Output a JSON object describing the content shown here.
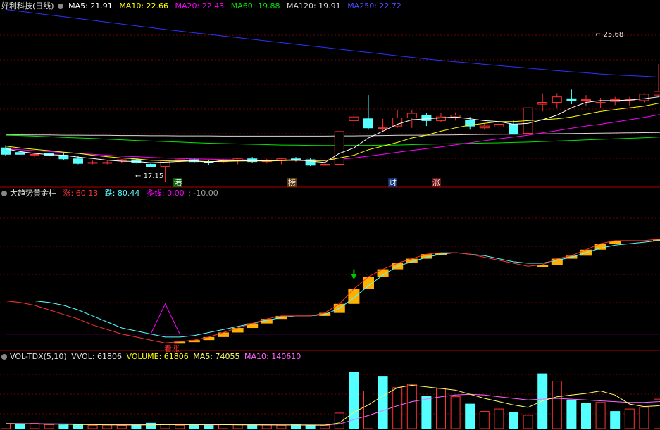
{
  "colors": {
    "up": "#ff3232",
    "down": "#54ffff",
    "ma5": "#ffffff",
    "ma10": "#ffff00",
    "ma20": "#ff00ff",
    "ma60": "#00e600",
    "ma120": "#d8d8d8",
    "ma250": "#3030ff",
    "gold": "#ffb000",
    "vol_ma5": "#ffff66",
    "vol_ma10": "#ff66ff"
  },
  "main_header": {
    "title": "好利科技(日线)",
    "ma5": "MA5: 21.91",
    "ma10": "MA10: 22.66",
    "ma20": "MA20: 22.43",
    "ma60": "MA60: 19.88",
    "ma120": "MA120: 19.91",
    "ma250": "MA250: 22.72"
  },
  "badges": [
    {
      "text": "港",
      "bg": "#0c5f0c",
      "fg": "#ffffff"
    },
    {
      "text": "榜",
      "bg": "#5f3a0c",
      "fg": "#ffffff"
    },
    {
      "text": "财",
      "bg": "#0c2f6f",
      "fg": "#ffffff"
    },
    {
      "text": "涨",
      "bg": "#6f0c0c",
      "fg": "#ffffff"
    }
  ],
  "price_labels": {
    "high": "25.68",
    "low": "17.15"
  },
  "ind_header": {
    "title": "大趋势黄金柱",
    "zhang": "涨: 60.13",
    "die": "跌: 80.44",
    "duoxian": "多线: 0.00",
    "extra": ": -10.00"
  },
  "ind_label": "看涨",
  "vol_header": {
    "title": "VOL-TDX(5,10)",
    "vvol": "VVOL: 61806",
    "volume": "VOLUME: 61806",
    "ma5": "MA5: 74055",
    "ma10": "MA10: 140610"
  },
  "chart_data": [
    {
      "type": "candlestick",
      "title": "好利科技(日线)",
      "ylim": [
        17.0,
        26.5
      ],
      "ohlc": [
        [
          19.0,
          19.15,
          18.55,
          18.65
        ],
        [
          18.75,
          18.85,
          18.6,
          18.65
        ],
        [
          18.65,
          18.75,
          18.5,
          18.65
        ],
        [
          18.7,
          18.75,
          18.55,
          18.6
        ],
        [
          18.6,
          18.7,
          18.35,
          18.4
        ],
        [
          18.4,
          18.55,
          18.1,
          18.15
        ],
        [
          18.2,
          18.3,
          18.1,
          18.2
        ],
        [
          18.2,
          18.3,
          18.1,
          18.2
        ],
        [
          18.3,
          18.4,
          18.2,
          18.35
        ],
        [
          18.35,
          18.4,
          18.15,
          18.2
        ],
        [
          18.1,
          18.15,
          17.95,
          17.98
        ],
        [
          17.98,
          18.35,
          17.15,
          18.3
        ],
        [
          18.3,
          18.4,
          18.2,
          18.35
        ],
        [
          18.35,
          18.45,
          18.2,
          18.25
        ],
        [
          18.25,
          18.35,
          18.05,
          18.2
        ],
        [
          18.25,
          18.4,
          18.15,
          18.3
        ],
        [
          18.3,
          18.45,
          18.1,
          18.4
        ],
        [
          18.4,
          18.5,
          18.2,
          18.25
        ],
        [
          18.25,
          18.4,
          18.15,
          18.3
        ],
        [
          18.3,
          18.45,
          18.1,
          18.4
        ],
        [
          18.4,
          18.5,
          18.25,
          18.35
        ],
        [
          18.35,
          18.45,
          18.0,
          18.05
        ],
        [
          18.05,
          18.15,
          18.0,
          18.1
        ],
        [
          18.1,
          19.9,
          18.05,
          19.9
        ],
        [
          20.5,
          20.9,
          20.0,
          20.7
        ],
        [
          20.6,
          21.9,
          20.0,
          20.1
        ],
        [
          20.1,
          20.6,
          19.9,
          20.1
        ],
        [
          20.2,
          21.1,
          20.1,
          20.65
        ],
        [
          20.65,
          21.1,
          20.1,
          20.9
        ],
        [
          20.8,
          20.9,
          20.2,
          20.5
        ],
        [
          20.5,
          20.9,
          20.4,
          20.7
        ],
        [
          20.7,
          20.95,
          20.5,
          20.8
        ],
        [
          20.5,
          20.7,
          20.0,
          20.2
        ],
        [
          20.1,
          20.35,
          20.0,
          20.2
        ],
        [
          20.15,
          20.4,
          20.05,
          20.3
        ],
        [
          20.3,
          20.5,
          19.8,
          19.8
        ],
        [
          19.8,
          21.2,
          19.75,
          21.2
        ],
        [
          21.4,
          22.0,
          21.0,
          21.5
        ],
        [
          21.5,
          22.0,
          21.2,
          21.8
        ],
        [
          21.7,
          22.2,
          21.4,
          21.6
        ],
        [
          21.65,
          21.9,
          21.3,
          21.65
        ],
        [
          21.5,
          21.75,
          21.2,
          21.5
        ],
        [
          21.55,
          21.8,
          21.35,
          21.65
        ],
        [
          21.6,
          21.8,
          21.3,
          21.65
        ],
        [
          21.6,
          22.0,
          21.5,
          21.95
        ],
        [
          21.9,
          23.6,
          21.8,
          22.1
        ],
        [
          22.1,
          24.3,
          22.0,
          23.7
        ],
        [
          23.0,
          24.0,
          22.8,
          23.2
        ],
        [
          23.2,
          24.8,
          23.0,
          24.4
        ],
        [
          24.7,
          25.68,
          22.9,
          24.9
        ],
        [
          24.7,
          25.0,
          23.7,
          24.0
        ],
        [
          23.4,
          23.7,
          22.8,
          22.7
        ],
        [
          22.7,
          23.2,
          22.4,
          23.1
        ],
        [
          23.0,
          23.3,
          22.3,
          22.4
        ]
      ],
      "ma5": [
        18.95,
        18.8,
        18.7,
        18.63,
        18.6,
        18.5,
        18.42,
        18.33,
        18.27,
        18.26,
        18.19,
        18.22,
        18.26,
        18.29,
        18.22,
        18.3,
        18.3,
        18.29,
        18.3,
        18.33,
        18.35,
        18.28,
        18.2,
        18.7,
        19.0,
        19.55,
        19.92,
        20.3,
        20.55,
        20.6,
        20.65,
        20.7,
        20.6,
        20.5,
        20.45,
        20.3,
        20.35,
        20.55,
        20.8,
        21.2,
        21.5,
        21.6,
        21.6,
        21.63,
        21.7,
        21.8,
        22.25,
        22.65,
        23.05,
        23.7,
        23.95,
        23.9,
        23.55,
        23.0
      ],
      "ma10": [
        19.1,
        19.0,
        18.92,
        18.85,
        18.77,
        18.7,
        18.6,
        18.52,
        18.45,
        18.4,
        18.32,
        18.3,
        18.3,
        18.28,
        18.25,
        18.26,
        18.28,
        18.29,
        18.28,
        18.3,
        18.32,
        18.3,
        18.3,
        18.45,
        18.6,
        18.9,
        19.1,
        19.3,
        19.55,
        19.7,
        19.92,
        20.1,
        20.25,
        20.35,
        20.45,
        20.45,
        20.5,
        20.55,
        20.6,
        20.7,
        20.85,
        21.0,
        21.1,
        21.2,
        21.3,
        21.45,
        21.6,
        21.8,
        22.0,
        22.3,
        22.6,
        22.8,
        22.9,
        22.66
      ],
      "ma20": [
        18.95,
        18.9,
        18.85,
        18.8,
        18.75,
        18.7,
        18.65,
        18.6,
        18.55,
        18.52,
        18.48,
        18.45,
        18.42,
        18.4,
        18.38,
        18.36,
        18.35,
        18.34,
        18.33,
        18.32,
        18.3,
        18.3,
        18.32,
        18.37,
        18.45,
        18.55,
        18.65,
        18.76,
        18.86,
        18.96,
        19.06,
        19.17,
        19.28,
        19.4,
        19.5,
        19.6,
        19.7,
        19.83,
        19.95,
        20.08,
        20.2,
        20.3,
        20.42,
        20.55,
        20.68,
        20.82,
        20.97,
        21.12,
        21.3,
        21.5,
        21.7,
        21.9,
        22.2,
        22.43
      ],
      "ma60": [
        19.7,
        19.68,
        19.65,
        19.62,
        19.58,
        19.55,
        19.52,
        19.48,
        19.45,
        19.41,
        19.38,
        19.35,
        19.32,
        19.29,
        19.26,
        19.24,
        19.22,
        19.2,
        19.18,
        19.16,
        19.15,
        19.14,
        19.13,
        19.13,
        19.13,
        19.14,
        19.15,
        19.16,
        19.18,
        19.2,
        19.22,
        19.23,
        19.25,
        19.27,
        19.28,
        19.3,
        19.32,
        19.35,
        19.38,
        19.41,
        19.44,
        19.47,
        19.5,
        19.53,
        19.56,
        19.6,
        19.63,
        19.67,
        19.7,
        19.73,
        19.77,
        19.8,
        19.84,
        19.88
      ],
      "ma120": [
        19.72,
        19.72,
        19.71,
        19.71,
        19.7,
        19.7,
        19.69,
        19.69,
        19.68,
        19.68,
        19.67,
        19.67,
        19.66,
        19.66,
        19.66,
        19.65,
        19.65,
        19.65,
        19.65,
        19.65,
        19.65,
        19.65,
        19.65,
        19.66,
        19.66,
        19.67,
        19.68,
        19.69,
        19.7,
        19.7,
        19.71,
        19.72,
        19.73,
        19.74,
        19.75,
        19.75,
        19.76,
        19.77,
        19.78,
        19.79,
        19.8,
        19.81,
        19.82,
        19.83,
        19.84,
        19.85,
        19.86,
        19.87,
        19.88,
        19.89,
        19.9,
        19.9,
        19.91,
        19.91
      ],
      "ma250": [
        26.6,
        26.5,
        26.4,
        26.3,
        26.2,
        26.1,
        26.0,
        25.9,
        25.8,
        25.7,
        25.6,
        25.5,
        25.41,
        25.32,
        25.23,
        25.14,
        25.05,
        24.96,
        24.87,
        24.78,
        24.69,
        24.6,
        24.51,
        24.42,
        24.33,
        24.24,
        24.15,
        24.06,
        23.97,
        23.88,
        23.8,
        23.73,
        23.66,
        23.59,
        23.52,
        23.45,
        23.38,
        23.31,
        23.24,
        23.18,
        23.12,
        23.06,
        23.01,
        22.97,
        22.93,
        22.89,
        22.86,
        22.83,
        22.8,
        22.78,
        22.76,
        22.74,
        22.73,
        22.72
      ]
    },
    {
      "type": "line",
      "title": "大趋势黄金柱",
      "ylim": [
        0,
        100
      ],
      "series": [
        {
          "name": "涨",
          "values": [
            32,
            31,
            29,
            26,
            23,
            20,
            16,
            13,
            10,
            8,
            6,
            4,
            5,
            6,
            8,
            11,
            14,
            17,
            20,
            22,
            22,
            22,
            24,
            30,
            40,
            48,
            53,
            57,
            60,
            63,
            64,
            64,
            63,
            61,
            59,
            57,
            55,
            56,
            60,
            62,
            66,
            70,
            72,
            72,
            72,
            73,
            74,
            76,
            78,
            82,
            84,
            83,
            74,
            60
          ]
        },
        {
          "name": "跌",
          "values": [
            32,
            32,
            32,
            31,
            29,
            26,
            22,
            18,
            14,
            12,
            10,
            8,
            8,
            9,
            11,
            13,
            15,
            17,
            19,
            21,
            22,
            22,
            23,
            27,
            34,
            42,
            49,
            55,
            58,
            61,
            63,
            64,
            63,
            62,
            60,
            58,
            57,
            57,
            59,
            61,
            64,
            67,
            69,
            70,
            71,
            72,
            73,
            74,
            76,
            79,
            82,
            84,
            80,
            73
          ]
        },
        {
          "name": "多线",
          "values": [
            10,
            10,
            10,
            10,
            10,
            10,
            10,
            10,
            10,
            10,
            10,
            10,
            10,
            10,
            10,
            10,
            10,
            10,
            10,
            10,
            10,
            10,
            10,
            10,
            10,
            10,
            10,
            10,
            10,
            10,
            10,
            10,
            10,
            10,
            10,
            10,
            10,
            10,
            10,
            10,
            10,
            10,
            10,
            10,
            10,
            10,
            10,
            10,
            10,
            10,
            10,
            10,
            10,
            10
          ]
        }
      ]
    },
    {
      "type": "bar",
      "title": "VOL-TDX(5,10)",
      "ylim": [
        0,
        400000
      ],
      "volume": [
        28000,
        30000,
        32000,
        24000,
        22000,
        26000,
        20000,
        22000,
        18000,
        20000,
        33000,
        28000,
        20000,
        25000,
        22000,
        24000,
        26000,
        20000,
        22000,
        20000,
        24000,
        18000,
        20000,
        95000,
        345000,
        230000,
        320000,
        250000,
        270000,
        200000,
        245000,
        195000,
        150000,
        105000,
        120000,
        100000,
        82000,
        335000,
        290000,
        175000,
        155000,
        160000,
        105000,
        120000,
        130000,
        180000,
        220000,
        380000,
        330000,
        300000,
        250000,
        200000,
        195000,
        61806
      ],
      "vol_up": [
        true,
        false,
        true,
        true,
        false,
        false,
        true,
        true,
        true,
        false,
        false,
        true,
        true,
        false,
        false,
        true,
        true,
        false,
        true,
        true,
        false,
        false,
        true,
        true,
        false,
        true,
        false,
        true,
        true,
        false,
        true,
        true,
        false,
        true,
        true,
        false,
        true,
        false,
        true,
        false,
        false,
        true,
        false,
        true,
        true,
        true,
        true,
        true,
        false,
        true,
        false,
        false,
        false,
        false
      ],
      "ma5": [
        30000,
        29000,
        28000,
        27000,
        27000,
        25000,
        24000,
        23000,
        22000,
        22000,
        23000,
        24000,
        24000,
        24000,
        25000,
        24000,
        23000,
        23000,
        22000,
        22000,
        22000,
        21000,
        21000,
        35000,
        100000,
        145000,
        200000,
        250000,
        265000,
        255000,
        245000,
        235000,
        210000,
        185000,
        165000,
        145000,
        130000,
        170000,
        195000,
        205000,
        215000,
        230000,
        205000,
        150000,
        135000,
        140000,
        160000,
        200000,
        245000,
        285000,
        290000,
        270000,
        250000,
        215000
      ],
      "ma10": [
        31000,
        30500,
        30000,
        29500,
        29000,
        28000,
        27000,
        26000,
        25500,
        25000,
        25000,
        24500,
        24000,
        23500,
        23000,
        23500,
        24000,
        24000,
        23500,
        23000,
        22500,
        22500,
        22000,
        28000,
        55000,
        80000,
        110000,
        140000,
        165000,
        180000,
        195000,
        205000,
        210000,
        205000,
        195000,
        185000,
        175000,
        180000,
        185000,
        180000,
        175000,
        170000,
        165000,
        160000,
        160000,
        165000,
        175000,
        185000,
        195000,
        205000,
        210000,
        200000,
        180000,
        140610
      ]
    }
  ]
}
